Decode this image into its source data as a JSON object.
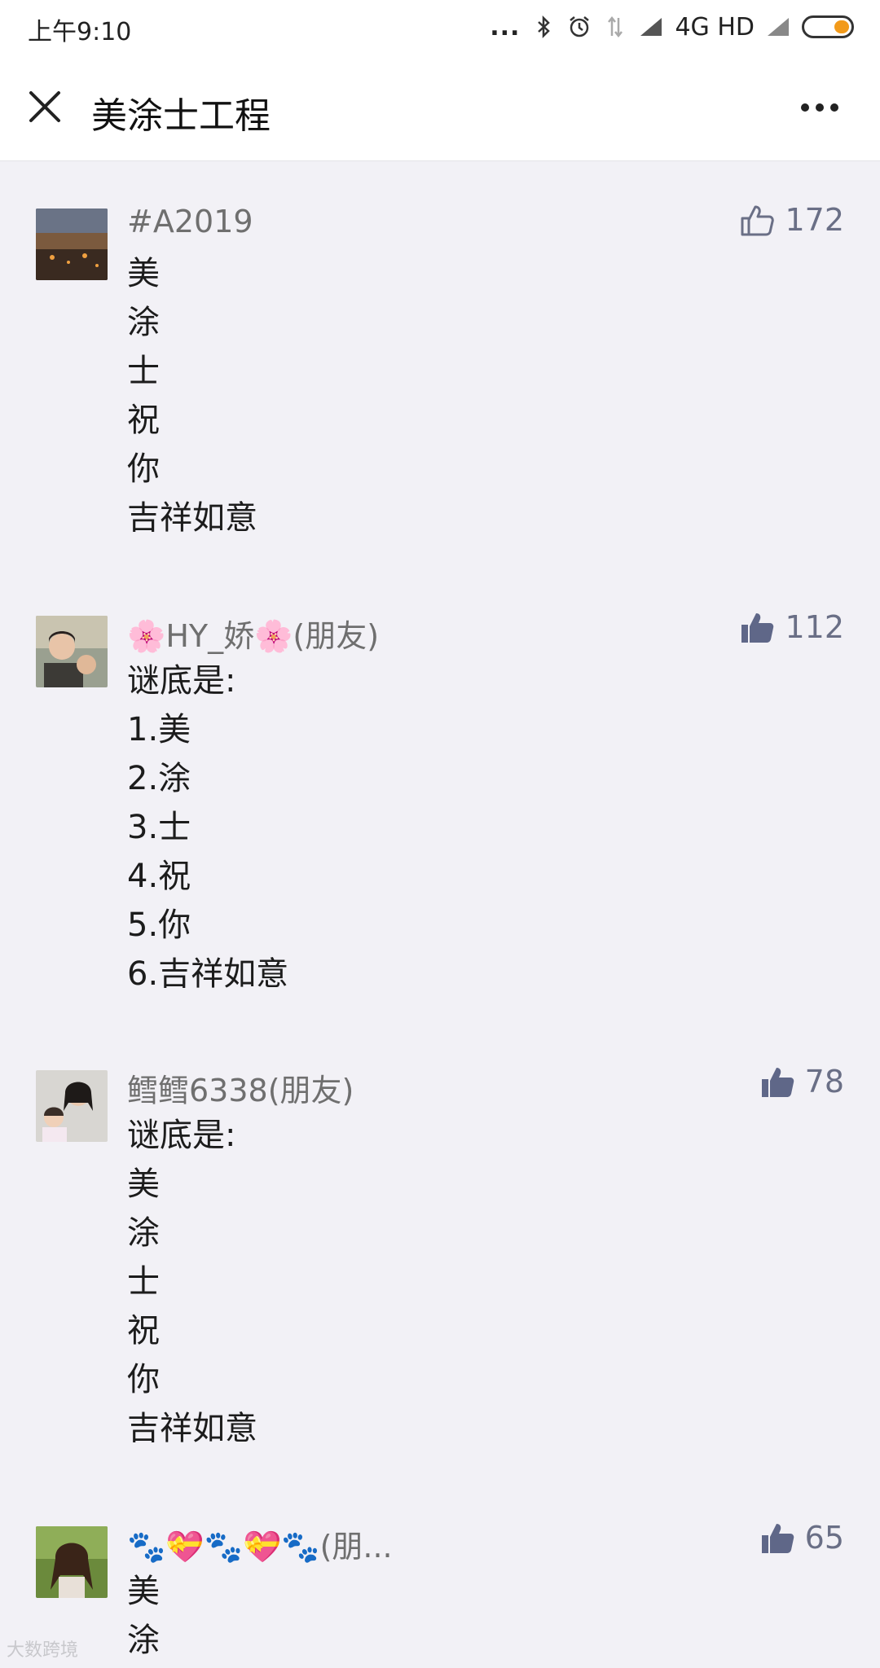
{
  "status": {
    "time": "上午9:10",
    "dots": "...",
    "network": "4G HD",
    "icons": [
      "bluetooth-icon",
      "alarm-icon",
      "data-arrows-icon",
      "signal-icon",
      "battery-icon"
    ]
  },
  "header": {
    "title": "美涂士工程",
    "close_icon": "close-icon",
    "more_icon": "more-icon"
  },
  "comments": [
    {
      "name": "#A2019",
      "likes": "172",
      "liked": false,
      "lines": [
        "美",
        "涂",
        "士",
        "祝",
        "你",
        "吉祥如意"
      ]
    },
    {
      "name": "🌸HY_娇🌸(朋友)",
      "likes": "112",
      "liked": true,
      "lines": [
        "谜底是:",
        "1.美",
        "2.涂",
        "3.士",
        "4.祝",
        "5.你",
        "6.吉祥如意"
      ]
    },
    {
      "name": "鳕鳕6338(朋友)",
      "likes": "78",
      "liked": true,
      "lines": [
        "谜底是:",
        "美",
        "涂",
        "士",
        "祝",
        "你",
        "吉祥如意"
      ]
    },
    {
      "name": "🐾💝🐾💝🐾(朋...",
      "likes": "65",
      "liked": true,
      "lines": [
        "美",
        "涂"
      ]
    }
  ],
  "colors": {
    "background": "#f2f1f6",
    "like": "#6a6f86",
    "name": "#6f6f6f",
    "battery": "#f29a1a"
  },
  "watermark": "大数跨境"
}
